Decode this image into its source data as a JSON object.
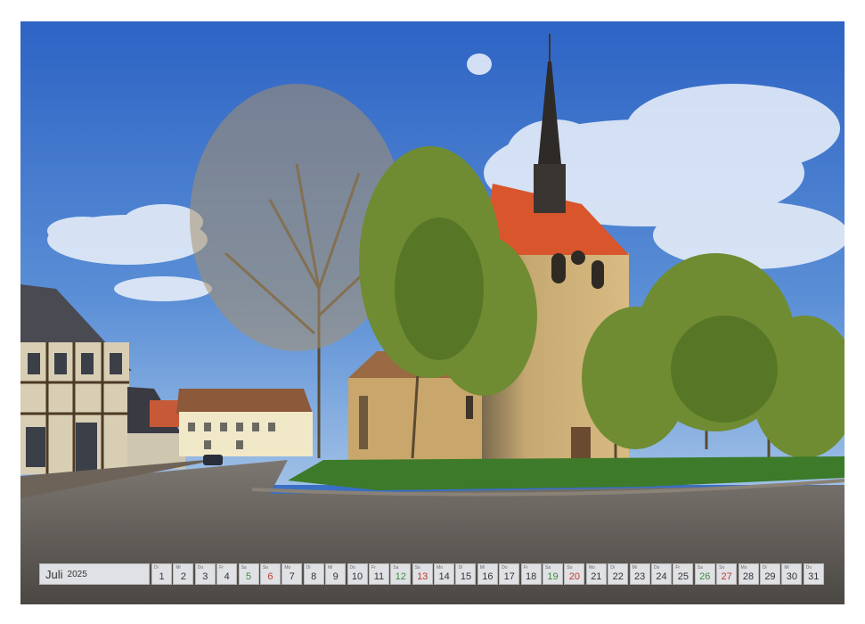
{
  "calendar": {
    "month": "Juli",
    "year": "2025",
    "days": [
      {
        "name": "Di",
        "num": "1",
        "type": "weekday"
      },
      {
        "name": "Mi",
        "num": "2",
        "type": "weekday"
      },
      {
        "name": "Do",
        "num": "3",
        "type": "weekday"
      },
      {
        "name": "Fr",
        "num": "4",
        "type": "weekday"
      },
      {
        "name": "Sa",
        "num": "5",
        "type": "sat"
      },
      {
        "name": "So",
        "num": "6",
        "type": "sun"
      },
      {
        "name": "Mo",
        "num": "7",
        "type": "weekday"
      },
      {
        "name": "Di",
        "num": "8",
        "type": "weekday"
      },
      {
        "name": "Mi",
        "num": "9",
        "type": "weekday"
      },
      {
        "name": "Do",
        "num": "10",
        "type": "weekday"
      },
      {
        "name": "Fr",
        "num": "11",
        "type": "weekday"
      },
      {
        "name": "Sa",
        "num": "12",
        "type": "sat"
      },
      {
        "name": "So",
        "num": "13",
        "type": "sun"
      },
      {
        "name": "Mo",
        "num": "14",
        "type": "weekday"
      },
      {
        "name": "Di",
        "num": "15",
        "type": "weekday"
      },
      {
        "name": "Mi",
        "num": "16",
        "type": "weekday"
      },
      {
        "name": "Do",
        "num": "17",
        "type": "weekday"
      },
      {
        "name": "Fr",
        "num": "18",
        "type": "weekday"
      },
      {
        "name": "Sa",
        "num": "19",
        "type": "sat"
      },
      {
        "name": "So",
        "num": "20",
        "type": "sun"
      },
      {
        "name": "Mo",
        "num": "21",
        "type": "weekday"
      },
      {
        "name": "Di",
        "num": "22",
        "type": "weekday"
      },
      {
        "name": "Mi",
        "num": "23",
        "type": "weekday"
      },
      {
        "name": "Do",
        "num": "24",
        "type": "weekday"
      },
      {
        "name": "Fr",
        "num": "25",
        "type": "weekday"
      },
      {
        "name": "Sa",
        "num": "26",
        "type": "sat"
      },
      {
        "name": "So",
        "num": "27",
        "type": "sun"
      },
      {
        "name": "Mo",
        "num": "28",
        "type": "weekday"
      },
      {
        "name": "Di",
        "num": "29",
        "type": "weekday"
      },
      {
        "name": "Mi",
        "num": "30",
        "type": "weekday"
      },
      {
        "name": "Do",
        "num": "31",
        "type": "weekday"
      }
    ]
  },
  "colors": {
    "saturday": "#3e8a3e",
    "sunday": "#c0392b",
    "sky": "#3a6fc4",
    "roof": "#d9552b"
  }
}
